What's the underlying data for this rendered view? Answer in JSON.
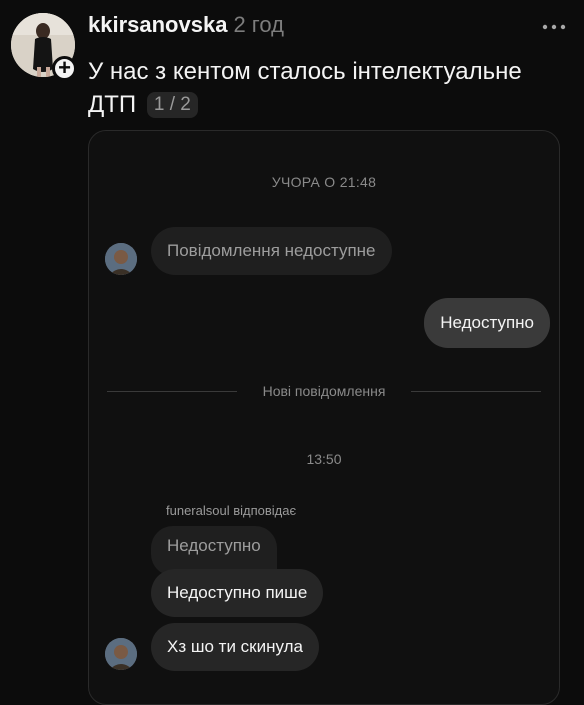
{
  "post": {
    "username": "kkirsanovska",
    "time": "2 год",
    "text": "У нас з кентом сталось інтелектуальне ДТП",
    "page_indicator": "1 / 2"
  },
  "chat": {
    "date_label": "УЧОРА О 21:48",
    "unavailable_message": "Повідомлення недоступне",
    "outgoing_message": "Недоступно",
    "new_messages_label": "Нові повідомлення",
    "time_label": "13:50",
    "reply_label": "funeralsoul відповідає",
    "replied_message": "Недоступно",
    "messages": [
      "Недоступно пише",
      "Хз шо ти скинула"
    ]
  },
  "colors": {
    "background": "#0c0c0c",
    "bubble_incoming": "#262626",
    "bubble_outgoing": "#3a3a3a"
  },
  "icons": [
    "avatar",
    "plus-icon",
    "more-icon",
    "chat-avatar"
  ]
}
